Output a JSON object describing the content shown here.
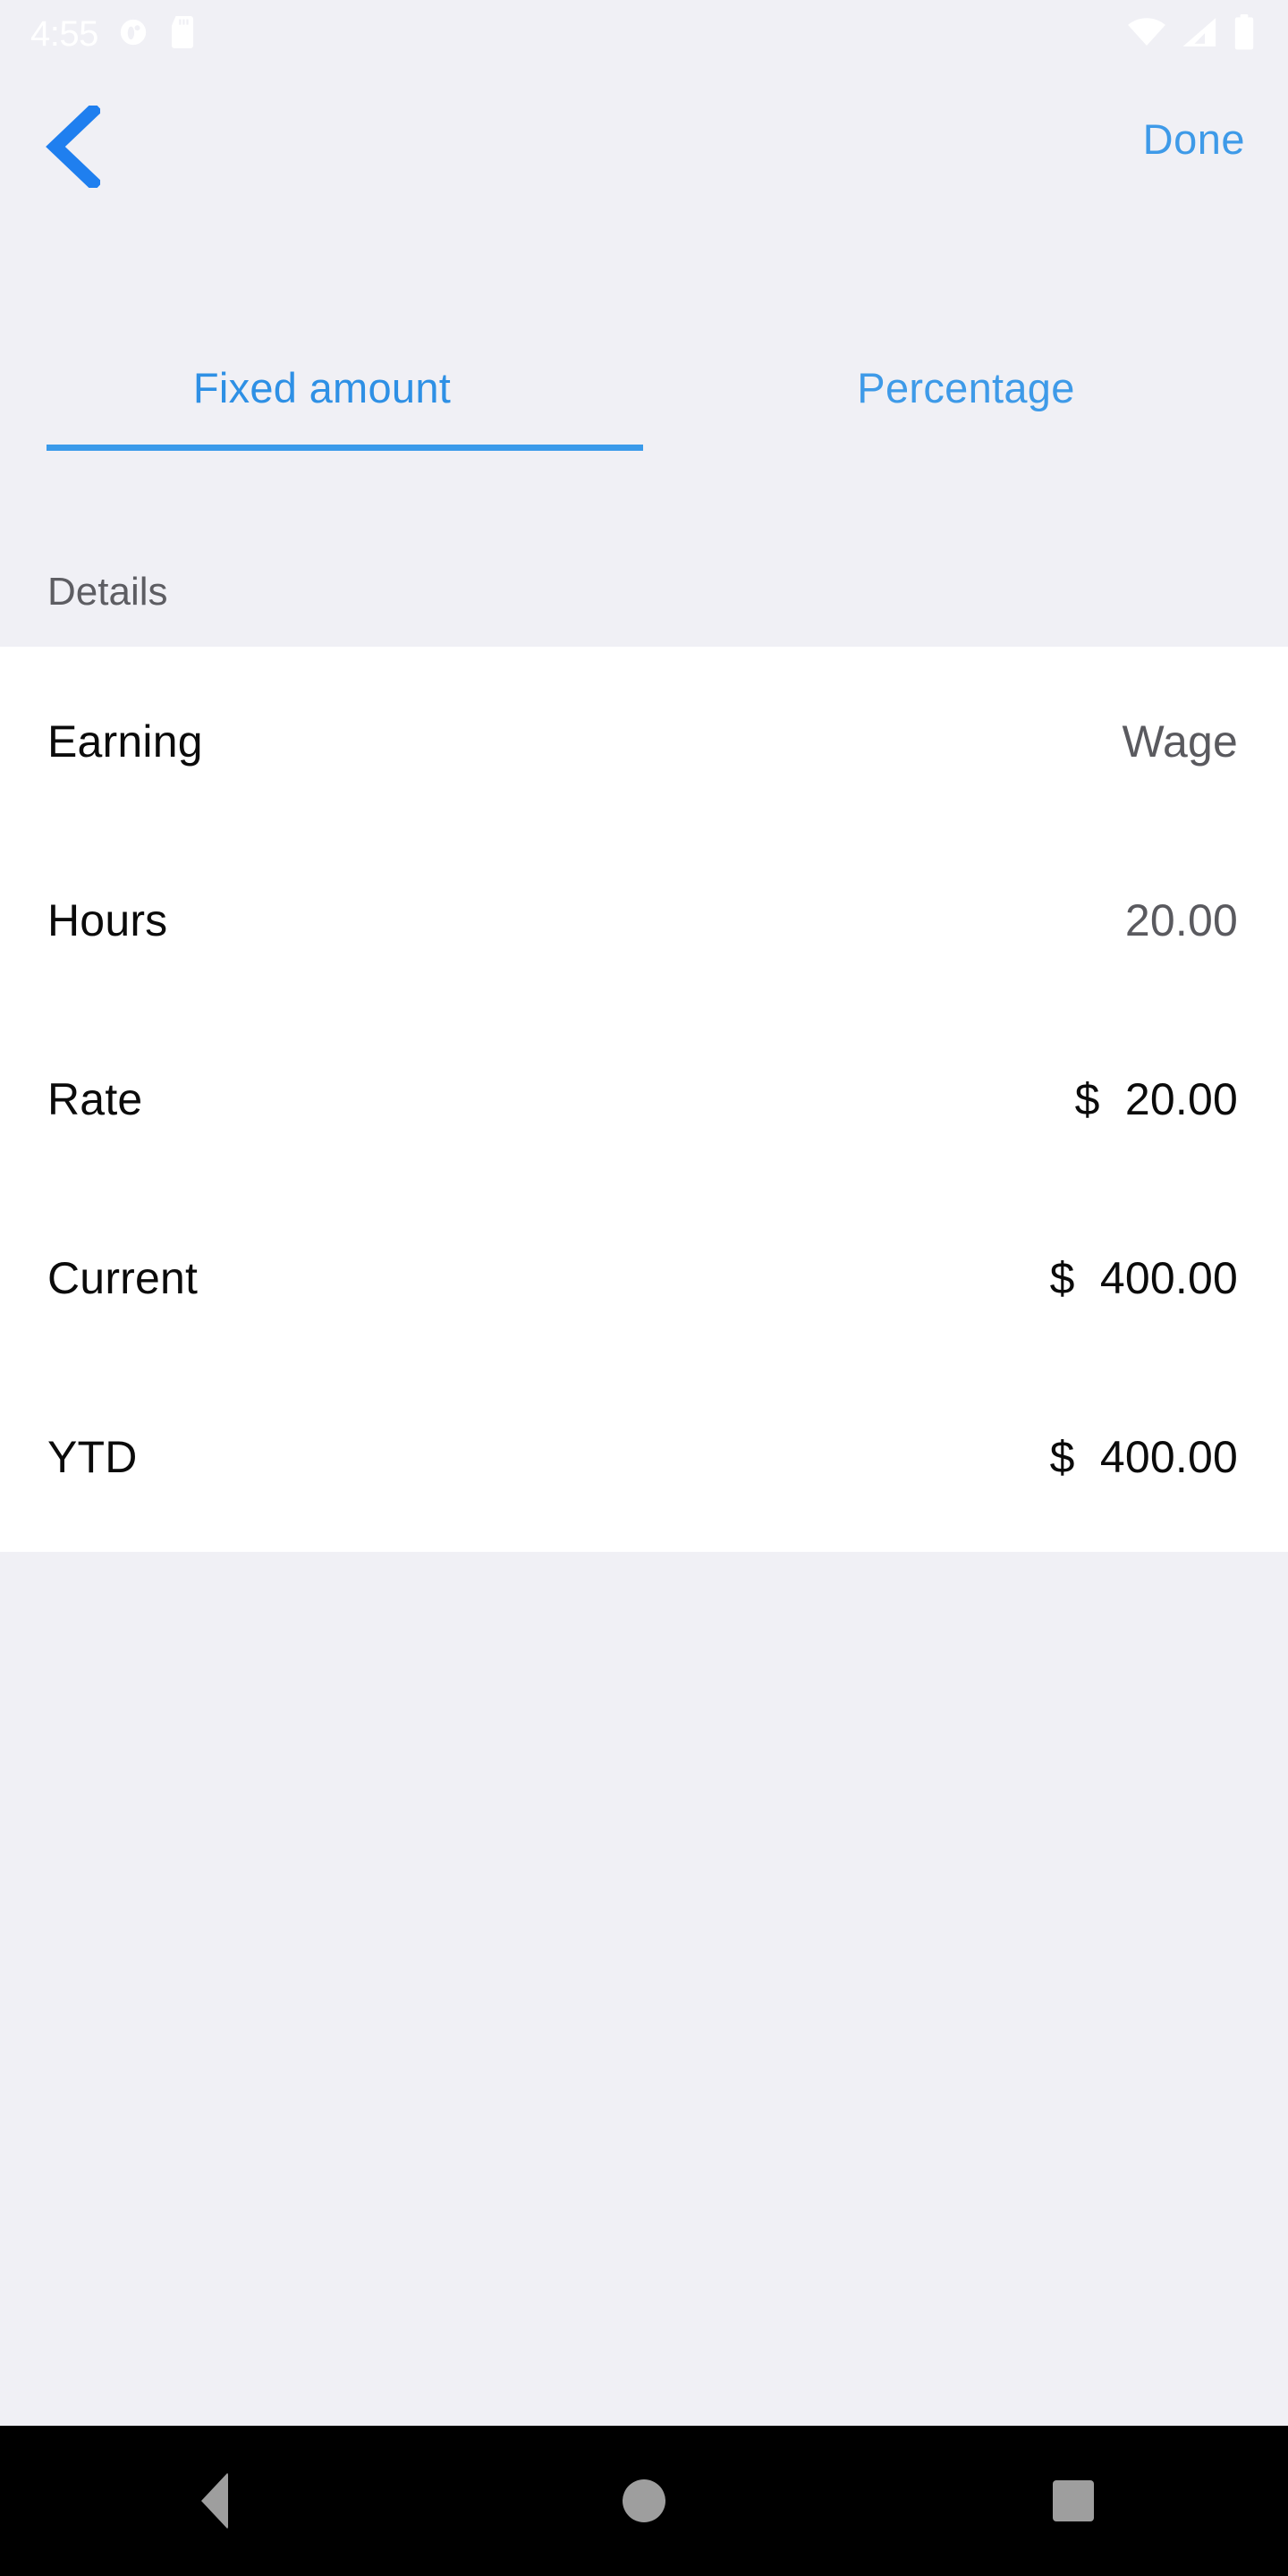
{
  "status_bar": {
    "time": "4:55",
    "left_icons": [
      "do-not-disturb-icon",
      "sd-card-icon"
    ],
    "right_icons": [
      "wifi-icon",
      "cellular-signal-icon",
      "battery-icon"
    ],
    "icon_color": "#ffffff"
  },
  "header": {
    "back_icon": "chevron-left-icon",
    "done_label": "Done",
    "accent_color": "#3e9ae8",
    "back_color": "#1f7fef"
  },
  "tabs": {
    "items": [
      {
        "label": "Fixed amount",
        "active": true
      },
      {
        "label": "Percentage",
        "active": false
      }
    ],
    "indicator_color": "#3a9aea"
  },
  "section": {
    "title": "Details"
  },
  "details": {
    "rows": [
      {
        "label": "Earning",
        "value": "Wage",
        "muted": true
      },
      {
        "label": "Hours",
        "value": "20.00",
        "muted": true
      },
      {
        "label": "Rate",
        "value": "$  20.00",
        "muted": false
      },
      {
        "label": "Current",
        "value": "$  400.00",
        "muted": false
      },
      {
        "label": "YTD",
        "value": "$  400.00",
        "muted": false
      }
    ]
  },
  "navbar": {
    "back_icon": "nav-back-triangle-icon",
    "home_icon": "nav-home-circle-icon",
    "recents_icon": "nav-recents-square-icon",
    "background": "#000000",
    "icon_color": "#9e9e9e"
  },
  "colors": {
    "page_background": "#f0f0f5",
    "list_background": "#ffffff",
    "primary_text": "#0b0b0b",
    "secondary_text": "#5a5a5f",
    "section_text": "#5d5d62"
  }
}
